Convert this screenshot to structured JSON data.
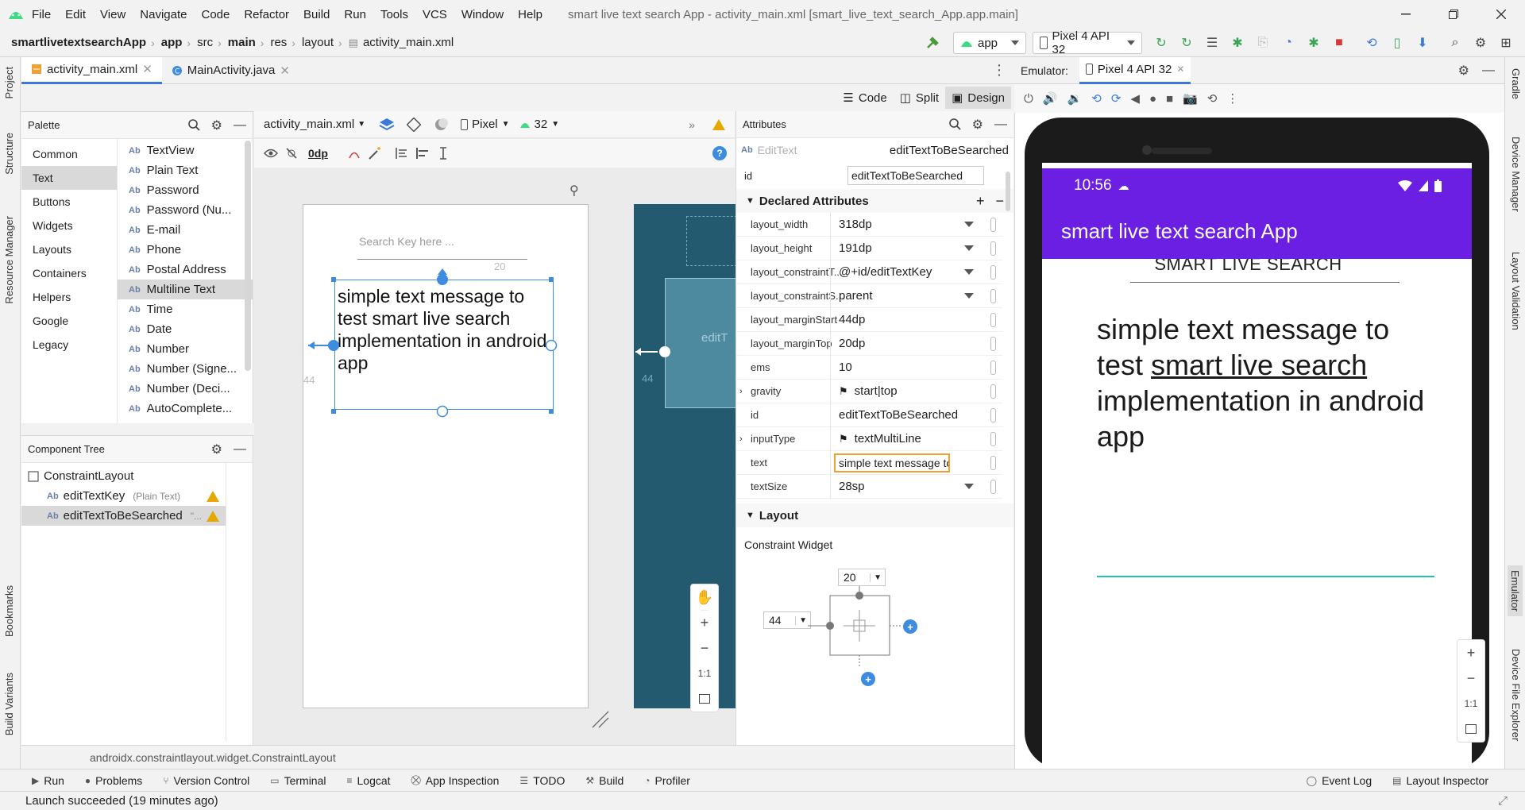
{
  "window": {
    "title": "smart live text search App - activity_main.xml [smart_live_text_search_App.app.main]",
    "menu": [
      "File",
      "Edit",
      "View",
      "Navigate",
      "Code",
      "Refactor",
      "Build",
      "Run",
      "Tools",
      "VCS",
      "Window",
      "Help"
    ]
  },
  "nav": {
    "crumbs": [
      "smartlivetextsearchApp",
      "app",
      "src",
      "main",
      "res",
      "layout",
      "activity_main.xml"
    ],
    "run_config": "app",
    "device": "Pixel 4 API 32"
  },
  "left_strip": [
    "Project",
    "Structure",
    "Resource Manager",
    "Bookmarks",
    "Build Variants"
  ],
  "right_strip": [
    "Gradle",
    "Device Manager",
    "Layout Validation",
    "Emulator",
    "Device File Explorer"
  ],
  "editor": {
    "tabs": [
      "activity_main.xml",
      "MainActivity.java"
    ],
    "modes": [
      "Code",
      "Split",
      "Design"
    ]
  },
  "palette": {
    "title": "Palette",
    "categories": [
      "Common",
      "Text",
      "Buttons",
      "Widgets",
      "Layouts",
      "Containers",
      "Helpers",
      "Google",
      "Legacy"
    ],
    "items": [
      "TextView",
      "Plain Text",
      "Password",
      "Password (Nu...",
      "E-mail",
      "Phone",
      "Postal Address",
      "Multiline Text",
      "Time",
      "Date",
      "Number",
      "Number (Signe...",
      "Number (Deci...",
      "AutoComplete..."
    ],
    "item_badge": "Ab"
  },
  "component_tree": {
    "title": "Component Tree",
    "root": "ConstraintLayout",
    "children": [
      {
        "name": "editTextKey",
        "hint": "(Plain Text)"
      },
      {
        "name": "editTextToBeSearched",
        "hint": "\"..."
      }
    ]
  },
  "canvas": {
    "file": "activity_main.xml",
    "device": "Pixel",
    "api": "32",
    "margin": "0dp",
    "hint_text": "Search Key here ...",
    "edit_text": "simple text message to test smart live search implementation in android app",
    "left_margin_label": "44",
    "top_margin_label": "20",
    "blueprint_label": "editT"
  },
  "attributes": {
    "title": "Attributes",
    "widget_type": "EditText",
    "widget_id": "editTextToBeSearched",
    "id_label": "id",
    "declared_title": "Declared Attributes",
    "declared": [
      {
        "name": "layout_width",
        "value": "318dp"
      },
      {
        "name": "layout_height",
        "value": "191dp"
      },
      {
        "name": "layout_constraintT...",
        "value": "@+id/editTextKey"
      },
      {
        "name": "layout_constraintS...",
        "value": "parent"
      },
      {
        "name": "layout_marginStart",
        "value": "44dp"
      },
      {
        "name": "layout_marginTop",
        "value": "20dp"
      },
      {
        "name": "ems",
        "value": "10"
      },
      {
        "name": "gravity",
        "value": "start|top"
      },
      {
        "name": "id",
        "value": "editTextToBeSearched"
      },
      {
        "name": "inputType",
        "value": "textMultiLine"
      },
      {
        "name": "text",
        "value": "simple text message to te"
      },
      {
        "name": "textSize",
        "value": "28sp"
      }
    ],
    "layout_title": "Layout",
    "constraint_widget": "Constraint Widget",
    "top_margin": "20",
    "start_margin": "44"
  },
  "emulator": {
    "label": "Emulator:",
    "device_tab": "Pixel 4 API 32",
    "time": "10:56",
    "app_title": "smart live text search App",
    "heading": "SMART LIVE SEARCH",
    "body_before": "simple text message to test ",
    "body_underlined": "smart live search",
    "body_after": " implementation in android app"
  },
  "breadcrumb_bottom": "androidx.constraintlayout.widget.ConstraintLayout",
  "tool_windows": [
    "Run",
    "Problems",
    "Version Control",
    "Terminal",
    "Logcat",
    "App Inspection",
    "TODO",
    "Build",
    "Profiler"
  ],
  "tool_windows_right": [
    "Event Log",
    "Layout Inspector"
  ],
  "status": "Launch succeeded (19 minutes ago)",
  "colors": {
    "accent": "#3d7ad6",
    "app_purple": "#6a1fe2",
    "teal": "#1ec3b1",
    "warning": "#e6a700",
    "blueprint": "#235a70"
  }
}
